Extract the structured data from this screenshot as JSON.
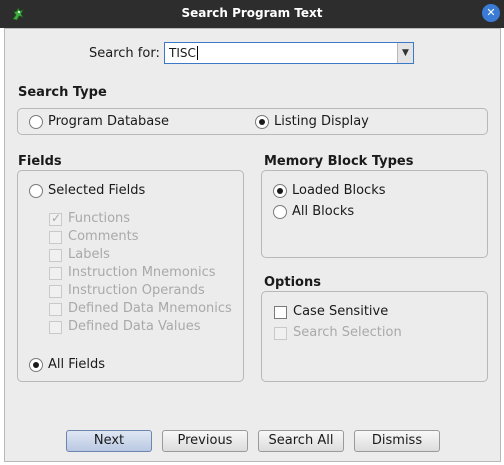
{
  "window": {
    "title": "Search Program Text",
    "app_icon": "dragon-icon",
    "close_icon": "close-icon"
  },
  "search": {
    "label": "Search for:",
    "value": "TISC"
  },
  "search_type": {
    "title": "Search Type",
    "options": [
      {
        "label": "Program Database",
        "selected": false
      },
      {
        "label": "Listing Display",
        "selected": true
      }
    ]
  },
  "fields": {
    "title": "Fields",
    "selected_fields_label": "Selected Fields",
    "items": [
      {
        "label": "Functions",
        "checked": true
      },
      {
        "label": "Comments",
        "checked": false
      },
      {
        "label": "Labels",
        "checked": false
      },
      {
        "label": "Instruction Mnemonics",
        "checked": false
      },
      {
        "label": "Instruction Operands",
        "checked": false
      },
      {
        "label": "Defined Data Mnemonics",
        "checked": false
      },
      {
        "label": "Defined Data Values",
        "checked": false
      }
    ],
    "all_fields_label": "All Fields"
  },
  "memory_blocks": {
    "title": "Memory Block Types",
    "options": [
      {
        "label": "Loaded Blocks",
        "selected": true
      },
      {
        "label": "All Blocks",
        "selected": false
      }
    ]
  },
  "options": {
    "title": "Options",
    "case_sensitive": "Case Sensitive",
    "search_selection": "Search Selection"
  },
  "buttons": {
    "next": "Next",
    "previous": "Previous",
    "search_all": "Search All",
    "dismiss": "Dismiss"
  },
  "colors": {
    "titlebar": "#2d2d2d",
    "dialog_bg": "#ececec",
    "accent": "#3a7bd5"
  }
}
